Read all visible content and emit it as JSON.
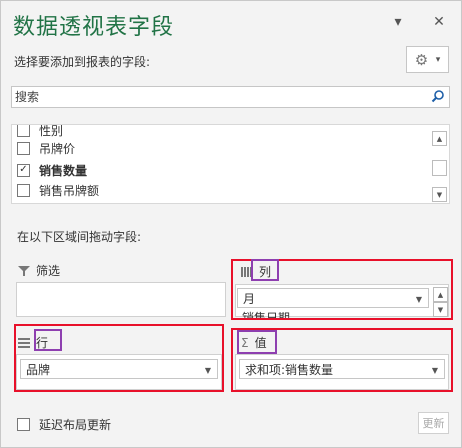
{
  "panel": {
    "title": "数据透视表字段",
    "subtitle": "选择要添加到报表的字段:",
    "accent_color": "#217346"
  },
  "header": {
    "dropdown_icon": "chevron-down-icon",
    "close_icon": "close-icon",
    "close_glyph": "✕",
    "dropdown_glyph": "▾"
  },
  "gear": {
    "icon": "gear-icon",
    "glyph": "⚙",
    "caret": "▾"
  },
  "search": {
    "placeholder": "搜索",
    "icon": "search-icon"
  },
  "fields": [
    {
      "label": "性别",
      "checked": false,
      "bold": false
    },
    {
      "label": "吊牌价",
      "checked": false,
      "bold": false
    },
    {
      "label": "销售数量",
      "checked": true,
      "bold": true
    },
    {
      "label": "销售吊牌额",
      "checked": false,
      "bold": false
    }
  ],
  "drag_instruction": "在以下区域间拖动字段:",
  "areas": {
    "filter": {
      "label": "筛选",
      "items": []
    },
    "columns": {
      "label": "列",
      "items": [
        "月",
        "销售日期"
      ]
    },
    "rows": {
      "label": "行",
      "items": [
        "品牌"
      ]
    },
    "values": {
      "label": "值",
      "items": [
        "求和项:销售数量"
      ]
    }
  },
  "footer": {
    "defer_label": "延迟布局更新",
    "update_label": "更新"
  },
  "highlight_colors": {
    "red": "#e8102a",
    "purple": "#8e3fb0"
  }
}
